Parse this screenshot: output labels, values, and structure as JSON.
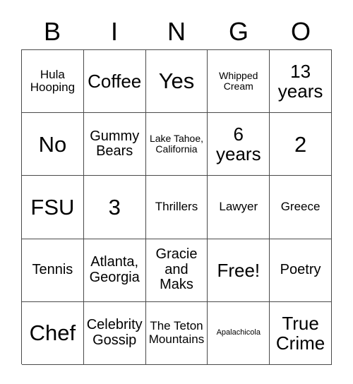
{
  "card": {
    "headers": [
      "B",
      "I",
      "N",
      "G",
      "O"
    ],
    "rows": [
      [
        {
          "text": "Hula Hooping",
          "size": "sm"
        },
        {
          "text": "Coffee",
          "size": "lg"
        },
        {
          "text": "Yes",
          "size": "xl"
        },
        {
          "text": "Whipped Cream",
          "size": "xs"
        },
        {
          "text": "13 years",
          "size": "lg"
        }
      ],
      [
        {
          "text": "No",
          "size": "xl"
        },
        {
          "text": "Gummy Bears",
          "size": "md"
        },
        {
          "text": "Lake Tahoe, California",
          "size": "xs"
        },
        {
          "text": "6 years",
          "size": "lg"
        },
        {
          "text": "2",
          "size": "xl"
        }
      ],
      [
        {
          "text": "FSU",
          "size": "xl"
        },
        {
          "text": "3",
          "size": "xl"
        },
        {
          "text": "Thrillers",
          "size": "sm"
        },
        {
          "text": "Lawyer",
          "size": "sm"
        },
        {
          "text": "Greece",
          "size": "sm"
        }
      ],
      [
        {
          "text": "Tennis",
          "size": "md"
        },
        {
          "text": "Atlanta, Georgia",
          "size": "md"
        },
        {
          "text": "Gracie and Maks",
          "size": "md"
        },
        {
          "text": "Free!",
          "size": "lg"
        },
        {
          "text": "Poetry",
          "size": "md"
        }
      ],
      [
        {
          "text": "Chef",
          "size": "xl"
        },
        {
          "text": "Celebrity Gossip",
          "size": "md"
        },
        {
          "text": "The Teton Mountains",
          "size": "sm"
        },
        {
          "text": "Apalachicola",
          "size": "xxs"
        },
        {
          "text": "True Crime",
          "size": "lg"
        }
      ]
    ]
  }
}
